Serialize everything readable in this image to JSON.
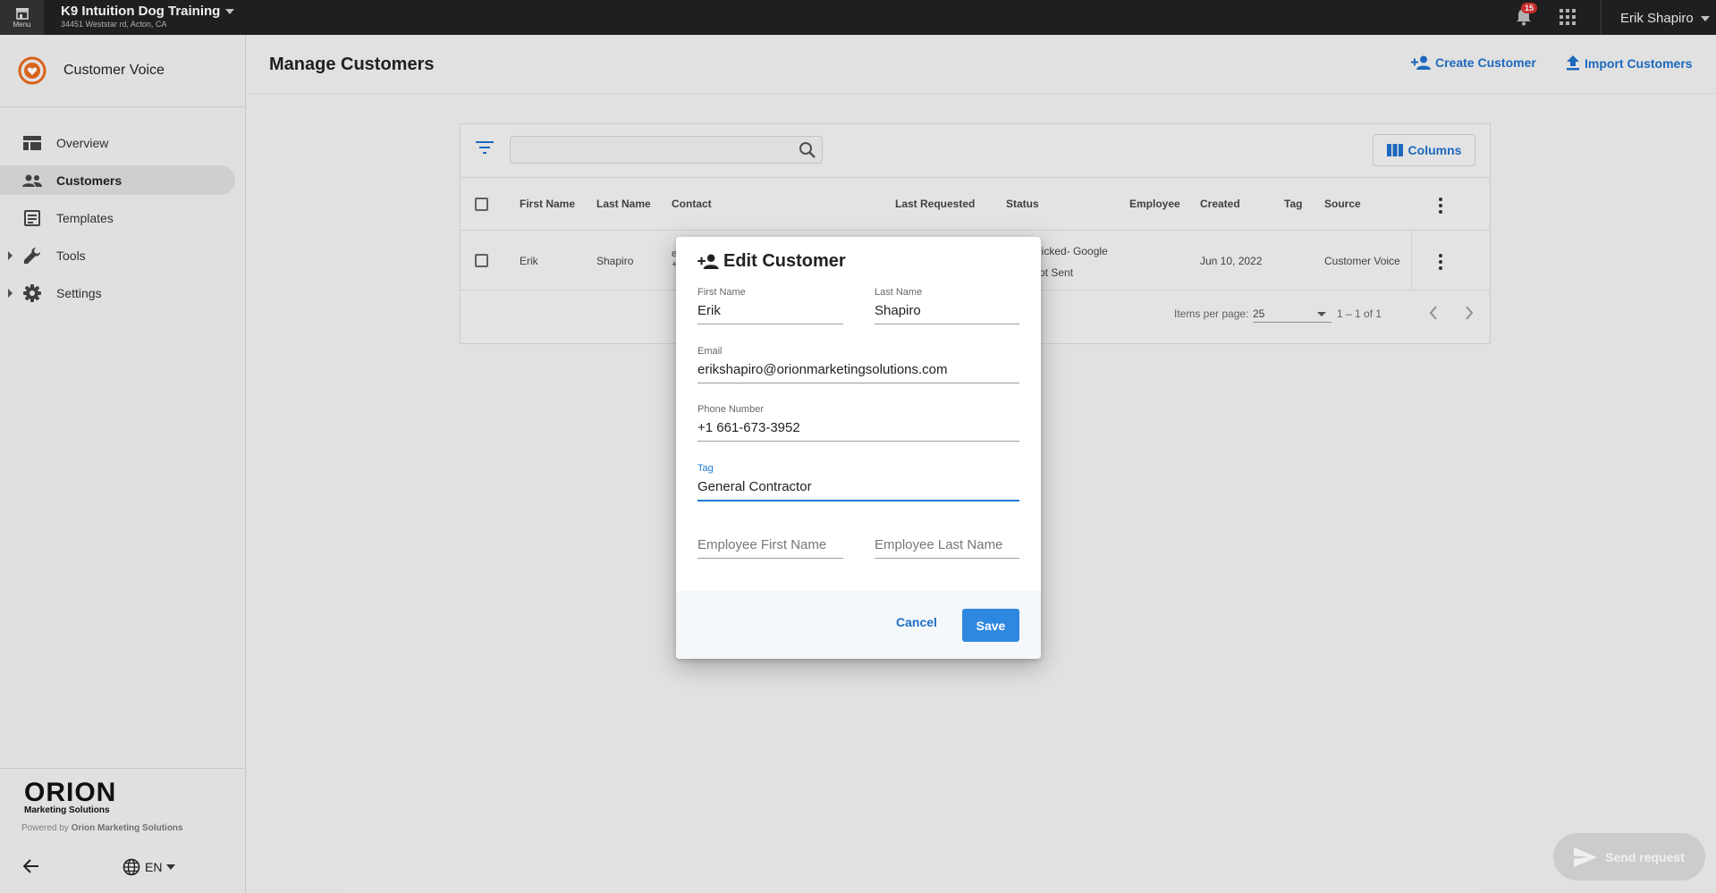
{
  "topbar": {
    "menu_label": "Menu",
    "business_name": "K9 Intuition Dog Training",
    "business_address": "34451 Weststar rd, Acton, CA",
    "notification_count": "15",
    "user_name": "Erik Shapiro"
  },
  "sidebar": {
    "product_name": "Customer Voice",
    "items": [
      {
        "label": "Overview",
        "icon": "overview-icon"
      },
      {
        "label": "Customers",
        "icon": "people-icon",
        "active": true
      },
      {
        "label": "Templates",
        "icon": "template-icon"
      },
      {
        "label": "Tools",
        "icon": "wrench-icon",
        "expandable": true
      },
      {
        "label": "Settings",
        "icon": "gear-icon",
        "expandable": true
      }
    ],
    "logo_text": "ORION",
    "logo_subtext": "Marketing Solutions",
    "powered_by_prefix": "Powered by ",
    "powered_by_name": "Orion Marketing Solutions",
    "language": "EN"
  },
  "header": {
    "title": "Manage Customers",
    "create_label": "Create Customer",
    "import_label": "Import Customers"
  },
  "table": {
    "search_placeholder": "",
    "columns_label": "Columns",
    "headers": [
      "First Name",
      "Last Name",
      "Contact",
      "Last Requested",
      "Status",
      "Employee",
      "Created",
      "Tag",
      "Source"
    ],
    "rows": [
      {
        "first_name": "Erik",
        "last_name": "Shapiro",
        "contact_line1": "e",
        "contact_line2": "+",
        "status_line1": "licked- Google",
        "status_line2": "ot Sent",
        "created": "Jun 10, 2022",
        "source": "Customer Voice"
      }
    ],
    "items_per_page_label": "Items per page:",
    "items_per_page_value": "25",
    "range_label": "1 – 1 of 1"
  },
  "send_request_label": "Send request",
  "dialog": {
    "title": "Edit Customer",
    "first_name_label": "First Name",
    "first_name_value": "Erik",
    "last_name_label": "Last Name",
    "last_name_value": "Shapiro",
    "email_label": "Email",
    "email_value": "erikshapiro@orionmarketingsolutions.com",
    "phone_label": "Phone Number",
    "phone_value": "+1 661-673-3952",
    "tag_label": "Tag",
    "tag_value": "General Contractor",
    "employee_first_placeholder": "Employee First Name",
    "employee_last_placeholder": "Employee Last Name",
    "cancel_label": "Cancel",
    "save_label": "Save"
  },
  "colors": {
    "accent": "#1e6fc9",
    "save_button": "#2f88e0",
    "brand_orange": "#e86a1c",
    "topbar": "#212121"
  }
}
